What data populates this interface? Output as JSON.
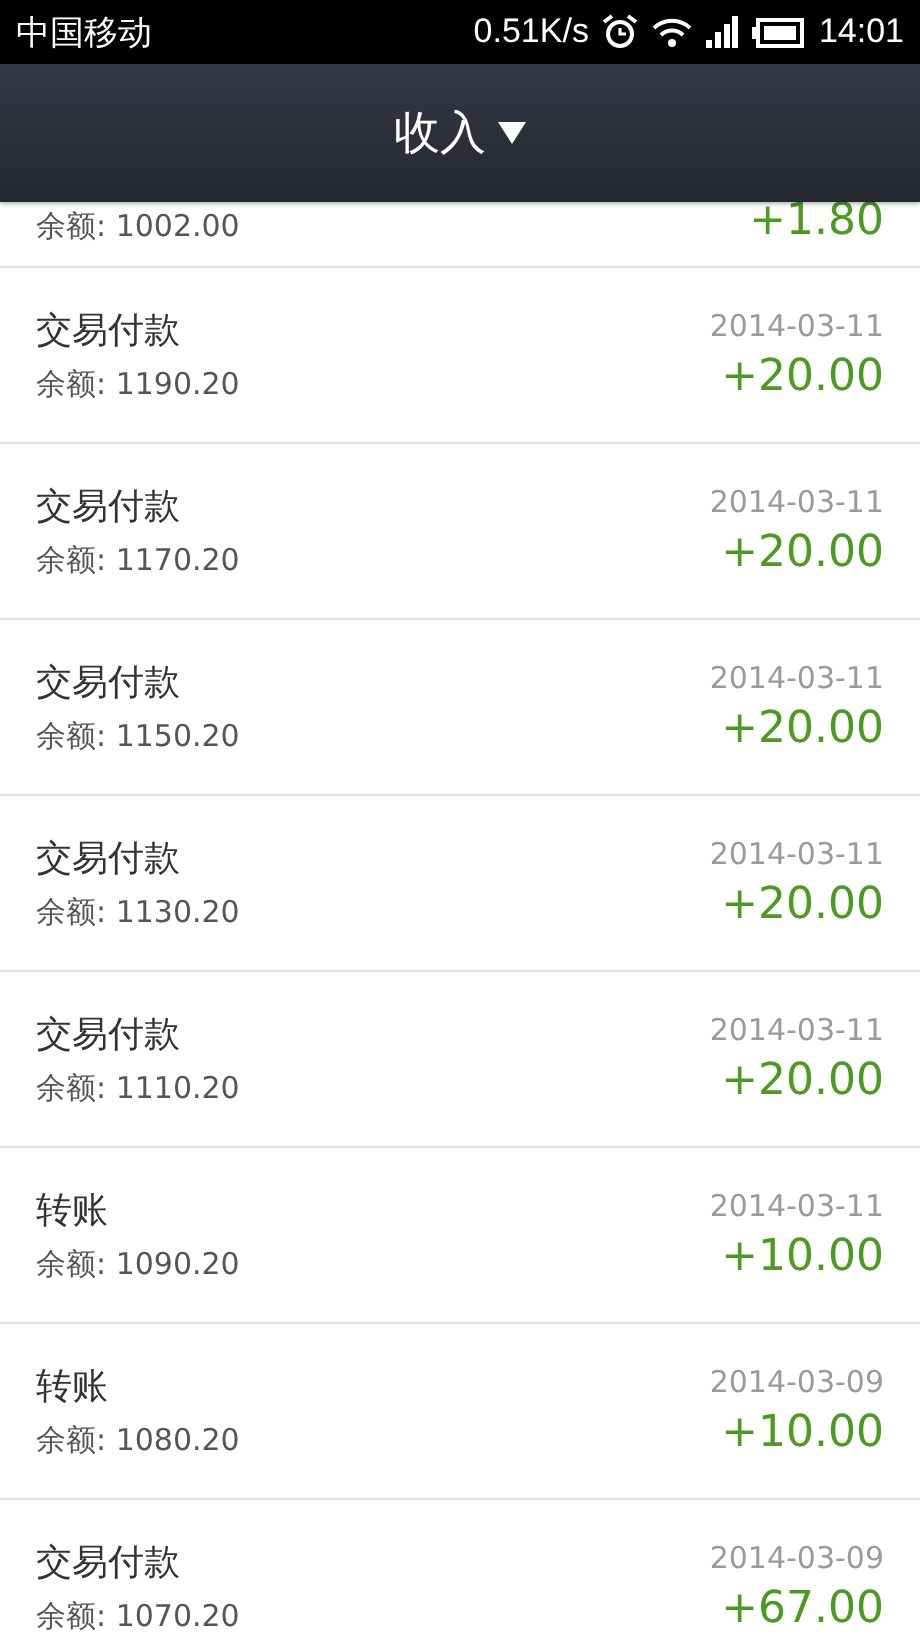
{
  "status_bar": {
    "carrier": "中国移动",
    "speed": "0.51K/s",
    "time": "14:01"
  },
  "header": {
    "title": "收入"
  },
  "transactions": [
    {
      "kind": "partial",
      "balance": "余额: 1002.00",
      "amount": "+1.80"
    },
    {
      "kind": "full",
      "title": "交易付款",
      "balance": "余额: 1190.20",
      "date": "2014-03-11",
      "amount": "+20.00"
    },
    {
      "kind": "full",
      "title": "交易付款",
      "balance": "余额: 1170.20",
      "date": "2014-03-11",
      "amount": "+20.00"
    },
    {
      "kind": "full",
      "title": "交易付款",
      "balance": "余额: 1150.20",
      "date": "2014-03-11",
      "amount": "+20.00"
    },
    {
      "kind": "full",
      "title": "交易付款",
      "balance": "余额: 1130.20",
      "date": "2014-03-11",
      "amount": "+20.00"
    },
    {
      "kind": "full",
      "title": "交易付款",
      "balance": "余额: 1110.20",
      "date": "2014-03-11",
      "amount": "+20.00"
    },
    {
      "kind": "full",
      "title": "转账",
      "balance": "余额: 1090.20",
      "date": "2014-03-11",
      "amount": "+10.00"
    },
    {
      "kind": "full",
      "title": "转账",
      "balance": "余额: 1080.20",
      "date": "2014-03-09",
      "amount": "+10.00"
    },
    {
      "kind": "full",
      "title": "交易付款",
      "balance": "余额: 1070.20",
      "date": "2014-03-09",
      "amount": "+67.00"
    }
  ]
}
